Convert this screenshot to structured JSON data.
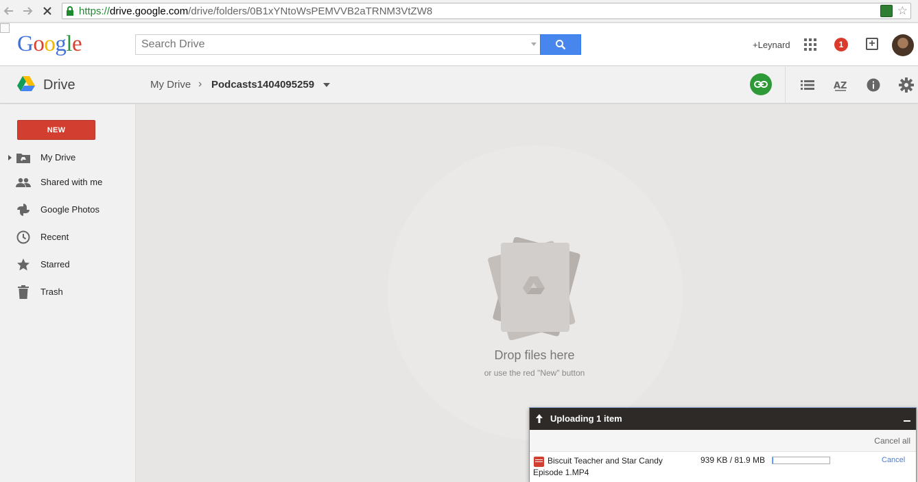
{
  "browser": {
    "url_scheme": "https://",
    "url_host": "drive.google.com",
    "url_path": "/drive/folders/0B1xYNtoWsPEMVVB2aTRNM3VtZW8"
  },
  "header": {
    "logo_letters": [
      "G",
      "o",
      "o",
      "g",
      "l",
      "e"
    ],
    "search_placeholder": "Search Drive",
    "user_name": "+Leynard",
    "notification_count": "1"
  },
  "toolbar": {
    "app_title": "Drive",
    "breadcrumb_root": "My Drive",
    "breadcrumb_current": "Podcasts1404095259",
    "link_color": "#2d9a37"
  },
  "sidebar": {
    "new_label": "NEW",
    "items": [
      {
        "label": "My Drive",
        "icon": "drive-folder-icon"
      },
      {
        "label": "Shared with me",
        "icon": "people-icon"
      },
      {
        "label": "Google Photos",
        "icon": "photos-pinwheel-icon"
      },
      {
        "label": "Recent",
        "icon": "clock-icon"
      },
      {
        "label": "Starred",
        "icon": "star-icon"
      },
      {
        "label": "Trash",
        "icon": "trash-icon"
      }
    ]
  },
  "main": {
    "drop_title": "Drop files here",
    "drop_subtitle": "or use the red \"New\" button"
  },
  "upload": {
    "title": "Uploading 1 item",
    "cancel_all": "Cancel all",
    "file_name": "Biscuit Teacher and Star Candy Episode 1.MP4",
    "file_size": "939 KB / 81.9 MB",
    "progress_fraction": 0.01,
    "cancel_label": "Cancel"
  }
}
